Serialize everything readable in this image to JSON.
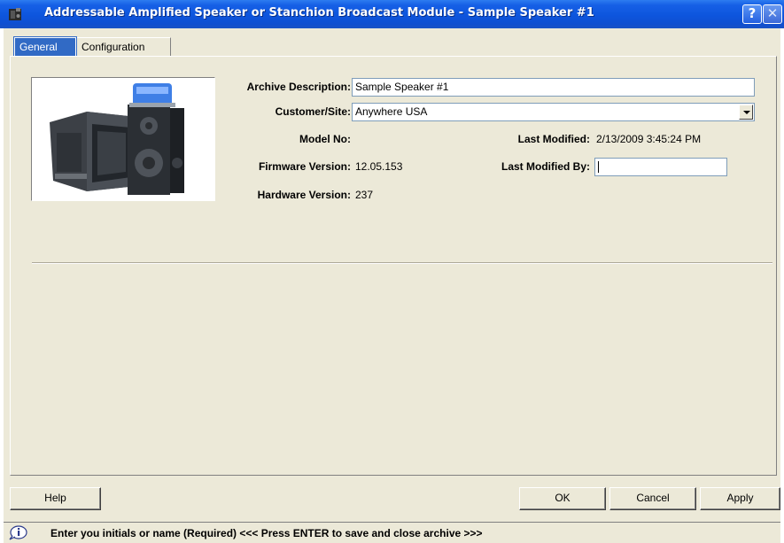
{
  "window": {
    "title": "Addressable Amplified Speaker or Stanchion Broadcast Module - Sample Speaker #1",
    "help_glyph": "?",
    "close_glyph": "✕",
    "icon": "speaker-app-icon"
  },
  "tabs": [
    {
      "label": "General",
      "selected": true
    },
    {
      "label": "Configuration",
      "selected": false
    }
  ],
  "general": {
    "archive_description": {
      "label": "Archive Description:",
      "value": "Sample Speaker #1"
    },
    "customer_site": {
      "label": "Customer/Site:",
      "value": "Anywhere USA"
    },
    "model_no": {
      "label": "Model No:",
      "value": ""
    },
    "firmware_version": {
      "label": "Firmware Version:",
      "value": "12.05.153"
    },
    "hardware_version": {
      "label": "Hardware Version:",
      "value": "237"
    },
    "last_modified": {
      "label": "Last Modified:",
      "value": "2/13/2009 3:45:24 PM"
    },
    "last_modified_by": {
      "label": "Last Modified By:",
      "value": ""
    }
  },
  "buttons": {
    "help": "Help",
    "ok": "OK",
    "cancel": "Cancel",
    "apply": "Apply"
  },
  "status": {
    "icon": "info-icon",
    "text": "Enter you initials or name (Required)   <<< Press ENTER to save and close archive >>>"
  },
  "colors": {
    "title_bar": "#0d55dd",
    "selected_tab": "#316ac5",
    "dialog_bg": "#ece9d8"
  }
}
